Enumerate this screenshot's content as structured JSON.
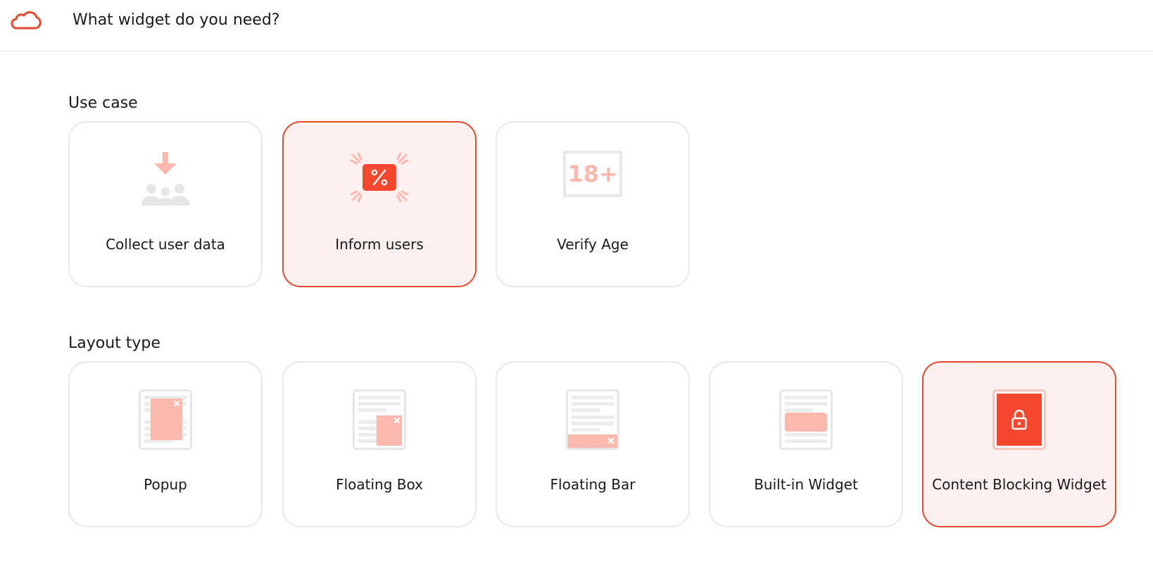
{
  "header": {
    "title": "What widget do you need?",
    "logo_icon": "cloud-icon"
  },
  "use_case": {
    "title": "Use case",
    "items": [
      {
        "label": "Collect user data",
        "icon": "collect-user-data-icon",
        "selected": false
      },
      {
        "label": "Inform users",
        "icon": "discount-percent-icon",
        "selected": true
      },
      {
        "label": "Verify Age",
        "icon": "age-18-plus-icon",
        "selected": false
      }
    ]
  },
  "layout_type": {
    "title": "Layout type",
    "items": [
      {
        "label": "Popup",
        "icon": "popup-layout-icon",
        "selected": false
      },
      {
        "label": "Floating Box",
        "icon": "floating-box-layout-icon",
        "selected": false
      },
      {
        "label": "Floating Bar",
        "icon": "floating-bar-layout-icon",
        "selected": false
      },
      {
        "label": "Built-in Widget",
        "icon": "built-in-widget-layout-icon",
        "selected": false
      },
      {
        "label": "Content Blocking Widget",
        "icon": "content-blocking-lock-icon",
        "selected": true
      }
    ]
  },
  "colors": {
    "accent": "#e24a30",
    "accent_light": "#fdb8ae",
    "selected_bg": "#fdf1f0",
    "border": "#e8e8e8"
  },
  "age_badge_text": "18+"
}
